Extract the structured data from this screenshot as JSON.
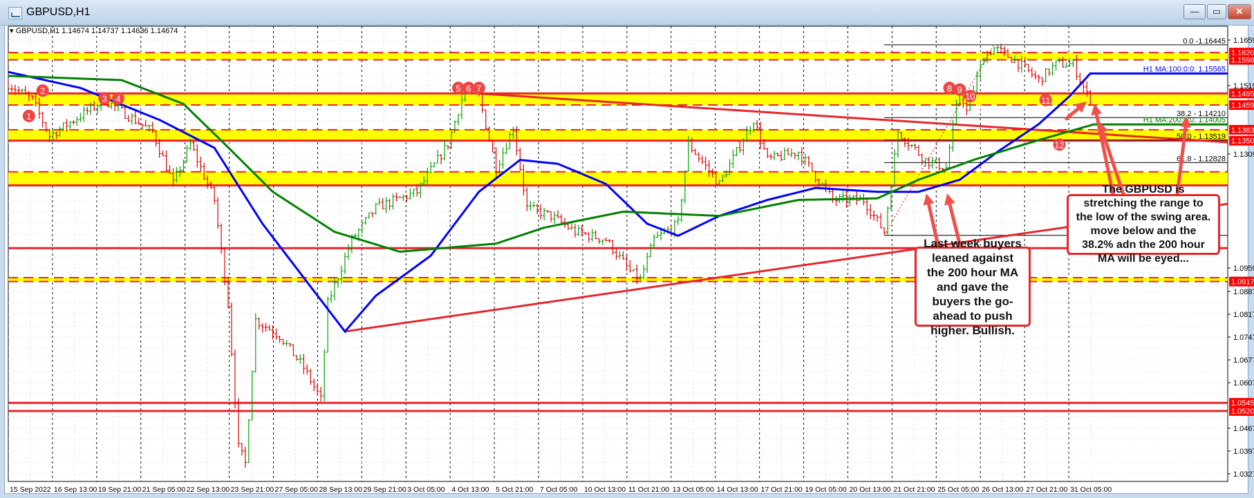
{
  "window": {
    "title": "GBPUSD,H1",
    "buttons": {
      "minimize": "—",
      "maximize": "▭",
      "close": "✕"
    }
  },
  "header": {
    "info": "GBPUSD,H1  1.14674 1.14737 1.14636 1.14674"
  },
  "colors": {
    "bull": "#00a000",
    "bear": "#e00000",
    "ma100": "#0000ff",
    "ma200": "#008000",
    "level": "#e8242b",
    "zone": "#ffff00",
    "fib": "#000000",
    "axis_label_bg": "#ff0000"
  },
  "chart_data": {
    "type": "candlestick",
    "symbol": "GBPUSD",
    "timeframe": "H1",
    "last_ohlc": {
      "open": 1.14674,
      "high": 1.14737,
      "low": 1.14636,
      "close": 1.14674
    },
    "xlim_bars": [
      0,
      355
    ],
    "ylim": [
      1.0327,
      1.1659
    ],
    "price_path": {
      "bars": [
        0,
        7,
        12,
        28,
        42,
        48,
        53,
        60,
        64,
        67,
        69,
        72,
        79,
        86,
        91,
        93,
        100,
        107,
        119,
        128,
        133,
        137,
        142,
        147,
        151,
        158,
        165,
        174,
        181,
        184,
        188,
        195,
        198,
        207,
        217,
        221,
        230,
        240,
        249,
        255,
        259,
        267,
        273,
        277,
        279,
        284,
        287,
        293,
        300,
        305,
        310,
        315
      ],
      "prices": [
        1.1524,
        1.1475,
        1.1365,
        1.1475,
        1.1377,
        1.1217,
        1.134,
        1.1168,
        1.085,
        1.0408,
        1.0359,
        1.08,
        1.0751,
        1.0653,
        1.0555,
        1.085,
        1.1046,
        1.1144,
        1.1193,
        1.134,
        1.1512,
        1.1487,
        1.1267,
        1.1389,
        1.1144,
        1.1119,
        1.107,
        1.1046,
        1.0948,
        1.0923,
        1.1046,
        1.1095,
        1.134,
        1.1217,
        1.1414,
        1.1291,
        1.1316,
        1.1168,
        1.1168,
        1.107,
        1.1377,
        1.1291,
        1.1267,
        1.1512,
        1.1438,
        1.161,
        1.1634,
        1.1597,
        1.1536,
        1.1585,
        1.1585,
        1.14674
      ]
    },
    "series": [
      {
        "name": "H1 MA:100:0:0",
        "label": "H1 MA:100:0:0: 1.15565",
        "color": "#0000ff",
        "bars": [
          0,
          21,
          44,
          60,
          74,
          98,
          107,
          123,
          137,
          149,
          160,
          174,
          186,
          195,
          207,
          221,
          235,
          253,
          265,
          277,
          288,
          300,
          309,
          315,
          355
        ],
        "prices": [
          1.1561,
          1.1512,
          1.1414,
          1.1328,
          1.1095,
          1.0764,
          1.0874,
          1.0997,
          1.1193,
          1.1291,
          1.1279,
          1.1217,
          1.1095,
          1.1058,
          1.1119,
          1.1168,
          1.1205,
          1.1193,
          1.1193,
          1.123,
          1.1316,
          1.1401,
          1.1487,
          1.15565,
          1.15565
        ]
      },
      {
        "name": "H1 MA:200:0:0",
        "label": "H1 MA:200:0:0: 1.14005",
        "color": "#008000",
        "bars": [
          0,
          33,
          51,
          63,
          77,
          95,
          114,
          142,
          156,
          179,
          207,
          230,
          253,
          265,
          281,
          300,
          316,
          355
        ],
        "prices": [
          1.1549,
          1.1536,
          1.1463,
          1.134,
          1.1193,
          1.107,
          1.1009,
          1.1034,
          1.1083,
          1.1132,
          1.1119,
          1.1168,
          1.1173,
          1.123,
          1.1291,
          1.1352,
          1.14,
          1.14
        ]
      }
    ],
    "levels": [
      {
        "price": 1.16205,
        "label": "1.16205",
        "style": "dashed"
      },
      {
        "price": 1.15983,
        "label": "1.15983",
        "style": "dashed"
      },
      {
        "price": 1.14951,
        "label": "1.14951",
        "style": "solid"
      },
      {
        "price": 1.14595,
        "label": "1.14595",
        "style": "dashed"
      },
      {
        "price": 1.13835,
        "label": "1.13835",
        "style": "dashed"
      },
      {
        "price": 1.135,
        "label": "1.13500",
        "style": "solid"
      },
      {
        "price": 1.12545,
        "label": null,
        "style": "dashed"
      },
      {
        "price": 1.12129,
        "label": null,
        "style": "solid"
      },
      {
        "price": 1.102,
        "label": null,
        "style": "solid"
      },
      {
        "price": 1.09294,
        "label": null,
        "style": "dashed"
      },
      {
        "price": 1.09175,
        "label": "1.09175",
        "style": "dashed"
      },
      {
        "price": 1.0545,
        "label": "1.05450",
        "style": "solid"
      },
      {
        "price": 1.052,
        "label": "1.05200",
        "style": "solid"
      }
    ],
    "zones": [
      [
        1.16205,
        1.15983
      ],
      [
        1.14951,
        1.14595
      ],
      [
        1.13835,
        1.135
      ],
      [
        1.12545,
        1.12129
      ],
      [
        1.09294,
        1.09175
      ]
    ],
    "fibonacci": {
      "start_bar": 255,
      "levels": [
        {
          "ratio": 0.0,
          "price": 1.16445,
          "label": "0.0 -1.16445"
        },
        {
          "ratio": 38.2,
          "price": 1.1421,
          "label": "38.2 - 1.14210"
        },
        {
          "ratio": 50.0,
          "price": 1.13519,
          "label": "50.0 - 1.13519"
        },
        {
          "ratio": 61.8,
          "price": 1.12828,
          "label": "61.8 - 1.12828"
        },
        {
          "ratio": 100.0,
          "price": 1.10594,
          "label": null
        }
      ],
      "diagonal": [
        [
          255,
          1.10594
        ],
        [
          287,
          1.16445
        ]
      ]
    },
    "trendlines": [
      {
        "name": "descending",
        "from": [
          137,
          1.1495
        ],
        "to": [
          355,
          1.1345
        ]
      },
      {
        "name": "ascending",
        "from": [
          98,
          1.0764
        ],
        "to": [
          355,
          1.1156
        ]
      }
    ],
    "markers": [
      {
        "label": "1",
        "bar": 6,
        "price": 1.1426
      },
      {
        "label": "2",
        "bar": 10,
        "price": 1.1504
      },
      {
        "label": "3",
        "bar": 28,
        "price": 1.148
      },
      {
        "label": "4",
        "bar": 32,
        "price": 1.148
      },
      {
        "label": "5",
        "bar": 131,
        "price": 1.1512
      },
      {
        "label": "6",
        "bar": 134,
        "price": 1.1512
      },
      {
        "label": "7",
        "bar": 137,
        "price": 1.1512
      },
      {
        "label": "8",
        "bar": 274,
        "price": 1.1512
      },
      {
        "label": "9",
        "bar": 277,
        "price": 1.1507
      },
      {
        "label": "10",
        "bar": 280,
        "price": 1.1487
      },
      {
        "label": "11",
        "bar": 302,
        "price": 1.1475
      },
      {
        "label": "12",
        "bar": 306,
        "price": 1.1338
      }
    ],
    "yticks": [
      "1.16590",
      "1.15190",
      "1.13090",
      "1.09590",
      "1.08870",
      "1.08170",
      "1.07470",
      "1.06770",
      "1.06070",
      "1.04670",
      "1.03970",
      "1.03270"
    ],
    "xticks": [
      "15 Sep 2022",
      "16 Sep 13:00",
      "19 Sep 21:00",
      "21 Sep 05:00",
      "22 Sep 13:00",
      "23 Sep 21:00",
      "27 Sep 05:00",
      "28 Sep 13:00",
      "29 Sep 21:00",
      "3 Oct 05:00",
      "4 Oct 13:00",
      "5 Oct 21:00",
      "7 Oct 05:00",
      "10 Oct 13:00",
      "11 Oct 21:00",
      "13 Oct 05:00",
      "14 Oct 13:00",
      "17 Oct 21:00",
      "19 Oct 05:00",
      "20 Oct 13:00",
      "21 Oct 21:00",
      "25 Oct 05:00",
      "26 Oct 13:00",
      "27 Oct 21:00",
      "31 Oct 05:00"
    ]
  },
  "annotations": {
    "box_left": "Last week buyers leaned against the 200 hour MA and gave the buyers the go-ahead to push higher.   Bullish.",
    "box_right": "The GBPUSD is stretching the range to the low of the swing area. move below and the 38.2% adn the 200 hour MA will be eyed..."
  }
}
